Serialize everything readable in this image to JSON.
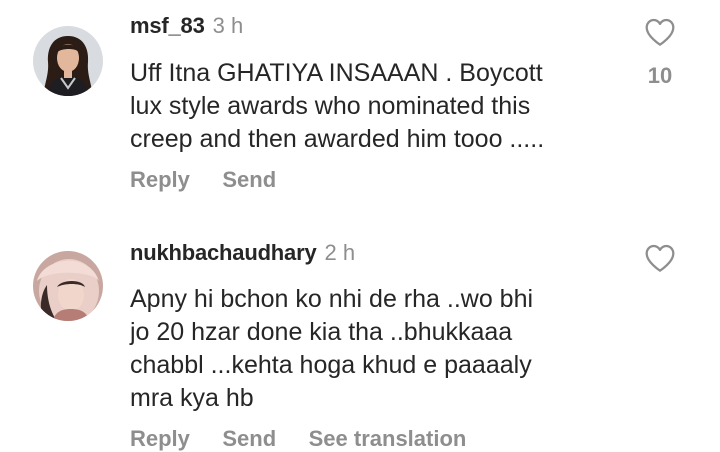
{
  "comments": [
    {
      "username": "msf_83",
      "time": "3 h",
      "lines": [
        "Uff Itna GHATIYA INSAAAN . Boycott",
        "lux style awards who nominated this",
        "creep and then awarded him tooo ....."
      ],
      "actions": [
        "Reply",
        "Send"
      ],
      "like_count": "10",
      "like_icon": "heart-outline-icon"
    },
    {
      "username": "nukhbachaudhary",
      "time": "2 h",
      "lines": [
        "Apny hi bchon ko nhi de rha ..wo bhi",
        "jo 20 hzar done kia tha ..bhukkaaa",
        "chabbl ...kehta hoga khud e paaaaly",
        "mra kya hb"
      ],
      "actions": [
        "Reply",
        "Send",
        "See translation"
      ],
      "like_icon": "heart-outline-icon"
    }
  ]
}
